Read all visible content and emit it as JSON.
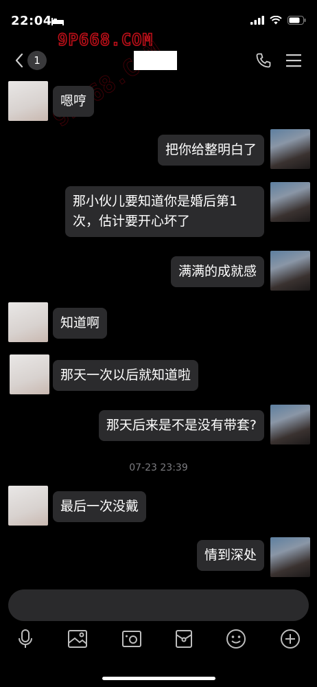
{
  "status_bar": {
    "time": "22:04"
  },
  "watermark": {
    "text": "9P668.COM"
  },
  "header": {
    "back_count": "1"
  },
  "messages": [
    {
      "side": "left",
      "text": "嗯哼"
    },
    {
      "side": "right",
      "text": "把你给整明白了"
    },
    {
      "side": "right",
      "text": "那小伙儿要知道你是婚后第1次，估计要开心坏了"
    },
    {
      "side": "right",
      "text": "满满的成就感"
    },
    {
      "side": "left",
      "text": "知道啊"
    },
    {
      "side": "left",
      "text": "那天一次以后就知道啦"
    },
    {
      "side": "right",
      "text": "那天后来是不是没有带套?"
    },
    {
      "side": "left",
      "text": "最后一次没戴"
    },
    {
      "side": "right",
      "text": "情到深处"
    }
  ],
  "timestamp": "07-23 23:39",
  "input": {
    "placeholder": ""
  },
  "toolbar": [
    "microphone-icon",
    "image-icon",
    "camera-icon",
    "red-packet-icon",
    "emoji-icon",
    "plus-icon"
  ]
}
